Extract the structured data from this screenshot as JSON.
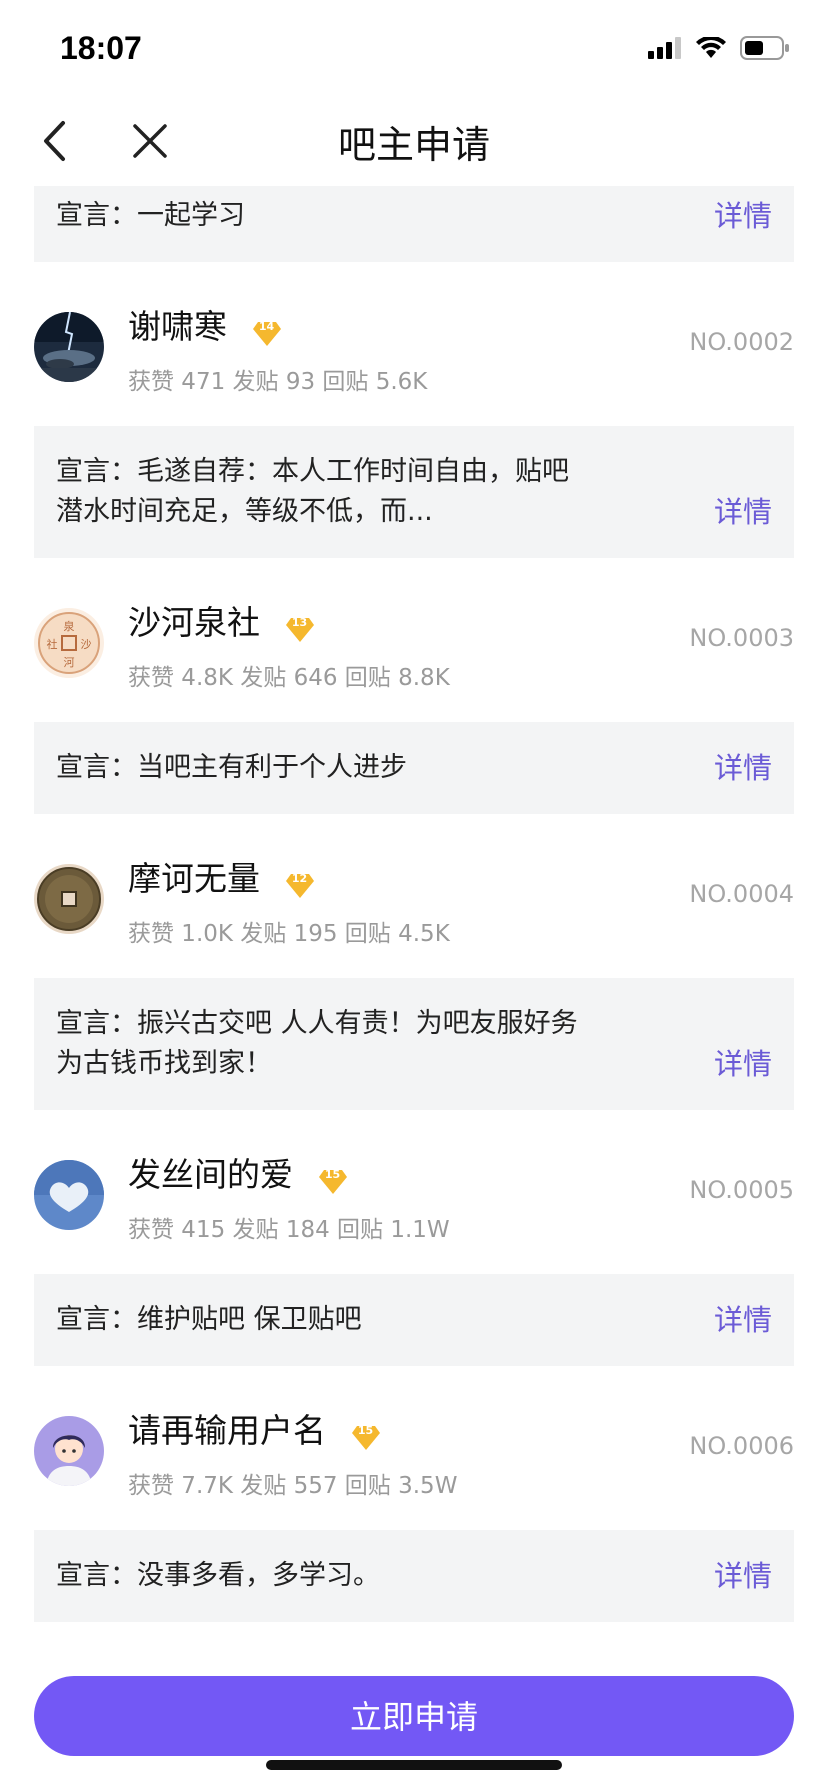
{
  "status": {
    "time": "18:07"
  },
  "nav": {
    "title": "吧主申请"
  },
  "first_motto": {
    "text": "宣言：一起学习",
    "detail": "详情"
  },
  "applicants": [
    {
      "name": "谢啸寒",
      "level": "14",
      "no": "NO.0002",
      "stats": "获赞 471 发贴 93 回贴 5.6K",
      "motto": "宣言：毛遂自荐：本人工作时间自由，贴吧潜水时间充足，等级不低，而...",
      "detail": "详情",
      "avatar": "storm-sea-icon"
    },
    {
      "name": "沙河泉社",
      "level": "13",
      "no": "NO.0003",
      "stats": "获赞 4.8K 发贴 646 回贴 8.8K",
      "motto": "宣言：当吧主有利于个人进步",
      "detail": "详情",
      "avatar": "seal-icon"
    },
    {
      "name": "摩诃无量",
      "level": "12",
      "no": "NO.0004",
      "stats": "获赞 1.0K 发贴 195 回贴 4.5K",
      "motto": "宣言：振兴古交吧 人人有责！为吧友服好务 为古钱币找到家！",
      "detail": "详情",
      "avatar": "coin-icon"
    },
    {
      "name": "发丝间的爱",
      "level": "15",
      "no": "NO.0005",
      "stats": "获赞 415 发贴 184 回贴 1.1W",
      "motto": "宣言：维护贴吧 保卫贴吧",
      "detail": "详情",
      "avatar": "heart-cloud-icon"
    },
    {
      "name": "请再输用户名",
      "level": "15",
      "no": "NO.0006",
      "stats": "获赞 7.7K 发贴 557 回贴 3.5W",
      "motto": "宣言：没事多看，多学习。",
      "detail": "详情",
      "avatar": "cartoon-boy-icon"
    }
  ],
  "footer": {
    "apply_label": "立即申请"
  },
  "colors": {
    "accent": "#7358f5",
    "detail": "#6b5bd6",
    "badge": "#f5b82e"
  }
}
